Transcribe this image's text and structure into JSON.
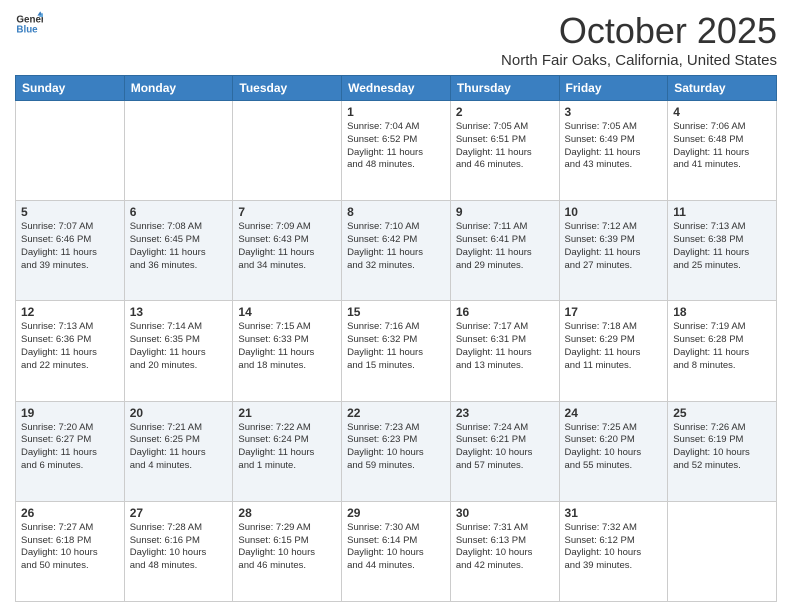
{
  "header": {
    "logo_line1": "General",
    "logo_line2": "Blue",
    "month": "October 2025",
    "location": "North Fair Oaks, California, United States"
  },
  "days_of_week": [
    "Sunday",
    "Monday",
    "Tuesday",
    "Wednesday",
    "Thursday",
    "Friday",
    "Saturday"
  ],
  "weeks": [
    [
      {
        "day": "",
        "info": ""
      },
      {
        "day": "",
        "info": ""
      },
      {
        "day": "",
        "info": ""
      },
      {
        "day": "1",
        "info": "Sunrise: 7:04 AM\nSunset: 6:52 PM\nDaylight: 11 hours\nand 48 minutes."
      },
      {
        "day": "2",
        "info": "Sunrise: 7:05 AM\nSunset: 6:51 PM\nDaylight: 11 hours\nand 46 minutes."
      },
      {
        "day": "3",
        "info": "Sunrise: 7:05 AM\nSunset: 6:49 PM\nDaylight: 11 hours\nand 43 minutes."
      },
      {
        "day": "4",
        "info": "Sunrise: 7:06 AM\nSunset: 6:48 PM\nDaylight: 11 hours\nand 41 minutes."
      }
    ],
    [
      {
        "day": "5",
        "info": "Sunrise: 7:07 AM\nSunset: 6:46 PM\nDaylight: 11 hours\nand 39 minutes."
      },
      {
        "day": "6",
        "info": "Sunrise: 7:08 AM\nSunset: 6:45 PM\nDaylight: 11 hours\nand 36 minutes."
      },
      {
        "day": "7",
        "info": "Sunrise: 7:09 AM\nSunset: 6:43 PM\nDaylight: 11 hours\nand 34 minutes."
      },
      {
        "day": "8",
        "info": "Sunrise: 7:10 AM\nSunset: 6:42 PM\nDaylight: 11 hours\nand 32 minutes."
      },
      {
        "day": "9",
        "info": "Sunrise: 7:11 AM\nSunset: 6:41 PM\nDaylight: 11 hours\nand 29 minutes."
      },
      {
        "day": "10",
        "info": "Sunrise: 7:12 AM\nSunset: 6:39 PM\nDaylight: 11 hours\nand 27 minutes."
      },
      {
        "day": "11",
        "info": "Sunrise: 7:13 AM\nSunset: 6:38 PM\nDaylight: 11 hours\nand 25 minutes."
      }
    ],
    [
      {
        "day": "12",
        "info": "Sunrise: 7:13 AM\nSunset: 6:36 PM\nDaylight: 11 hours\nand 22 minutes."
      },
      {
        "day": "13",
        "info": "Sunrise: 7:14 AM\nSunset: 6:35 PM\nDaylight: 11 hours\nand 20 minutes."
      },
      {
        "day": "14",
        "info": "Sunrise: 7:15 AM\nSunset: 6:33 PM\nDaylight: 11 hours\nand 18 minutes."
      },
      {
        "day": "15",
        "info": "Sunrise: 7:16 AM\nSunset: 6:32 PM\nDaylight: 11 hours\nand 15 minutes."
      },
      {
        "day": "16",
        "info": "Sunrise: 7:17 AM\nSunset: 6:31 PM\nDaylight: 11 hours\nand 13 minutes."
      },
      {
        "day": "17",
        "info": "Sunrise: 7:18 AM\nSunset: 6:29 PM\nDaylight: 11 hours\nand 11 minutes."
      },
      {
        "day": "18",
        "info": "Sunrise: 7:19 AM\nSunset: 6:28 PM\nDaylight: 11 hours\nand 8 minutes."
      }
    ],
    [
      {
        "day": "19",
        "info": "Sunrise: 7:20 AM\nSunset: 6:27 PM\nDaylight: 11 hours\nand 6 minutes."
      },
      {
        "day": "20",
        "info": "Sunrise: 7:21 AM\nSunset: 6:25 PM\nDaylight: 11 hours\nand 4 minutes."
      },
      {
        "day": "21",
        "info": "Sunrise: 7:22 AM\nSunset: 6:24 PM\nDaylight: 11 hours\nand 1 minute."
      },
      {
        "day": "22",
        "info": "Sunrise: 7:23 AM\nSunset: 6:23 PM\nDaylight: 10 hours\nand 59 minutes."
      },
      {
        "day": "23",
        "info": "Sunrise: 7:24 AM\nSunset: 6:21 PM\nDaylight: 10 hours\nand 57 minutes."
      },
      {
        "day": "24",
        "info": "Sunrise: 7:25 AM\nSunset: 6:20 PM\nDaylight: 10 hours\nand 55 minutes."
      },
      {
        "day": "25",
        "info": "Sunrise: 7:26 AM\nSunset: 6:19 PM\nDaylight: 10 hours\nand 52 minutes."
      }
    ],
    [
      {
        "day": "26",
        "info": "Sunrise: 7:27 AM\nSunset: 6:18 PM\nDaylight: 10 hours\nand 50 minutes."
      },
      {
        "day": "27",
        "info": "Sunrise: 7:28 AM\nSunset: 6:16 PM\nDaylight: 10 hours\nand 48 minutes."
      },
      {
        "day": "28",
        "info": "Sunrise: 7:29 AM\nSunset: 6:15 PM\nDaylight: 10 hours\nand 46 minutes."
      },
      {
        "day": "29",
        "info": "Sunrise: 7:30 AM\nSunset: 6:14 PM\nDaylight: 10 hours\nand 44 minutes."
      },
      {
        "day": "30",
        "info": "Sunrise: 7:31 AM\nSunset: 6:13 PM\nDaylight: 10 hours\nand 42 minutes."
      },
      {
        "day": "31",
        "info": "Sunrise: 7:32 AM\nSunset: 6:12 PM\nDaylight: 10 hours\nand 39 minutes."
      },
      {
        "day": "",
        "info": ""
      }
    ]
  ]
}
